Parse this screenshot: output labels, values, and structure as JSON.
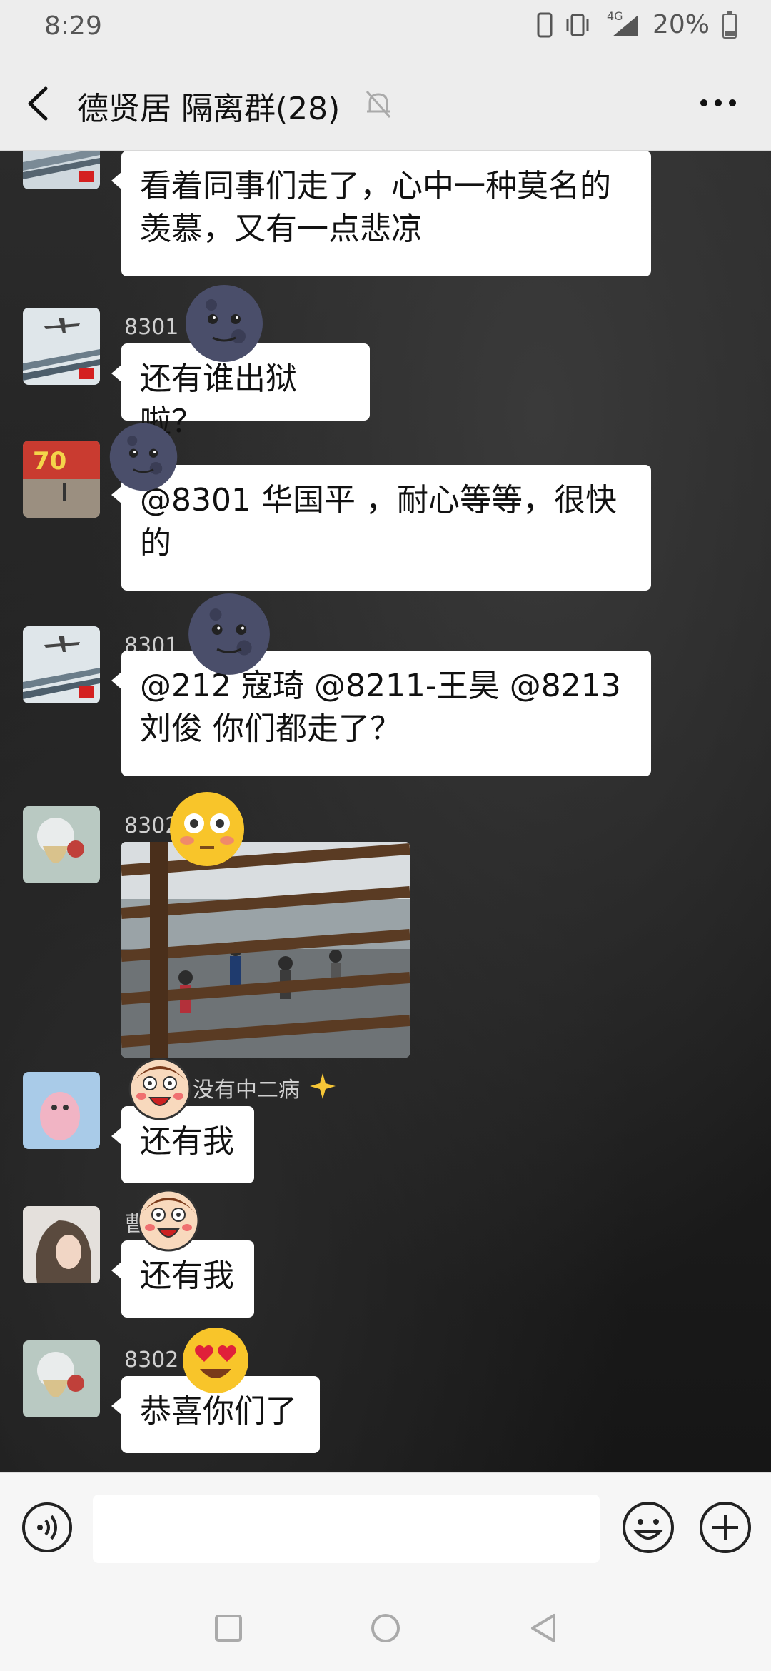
{
  "status_bar": {
    "time": "8:29",
    "network": "4G",
    "battery": "20%"
  },
  "header": {
    "title": "德贤居  隔离群(28)"
  },
  "messages": [
    {
      "sender": "",
      "text_lines": [
        "看着同事们走了，心中一种莫名的",
        "羡慕，又有一点悲凉"
      ]
    },
    {
      "sender": "8301",
      "text_lines": [
        "还有谁出狱啦？"
      ]
    },
    {
      "sender": "",
      "text_lines": [
        "@8301 华国平 ，耐心等等，很快",
        "的"
      ]
    },
    {
      "sender": "8301",
      "text_lines": [
        "@212 寇琦  @8211-王昊  @8213",
        "刘俊  你们都走了？"
      ]
    },
    {
      "sender": "8302",
      "image": "photo-railing"
    },
    {
      "sender": "没有中二病",
      "text_lines": [
        "还有我"
      ]
    },
    {
      "sender": "曹",
      "text_lines": [
        "还有我"
      ]
    },
    {
      "sender": "8302",
      "text_lines": [
        "恭喜你们了"
      ]
    }
  ],
  "input": {
    "placeholder": ""
  },
  "icons": {
    "back": "chevron-left-icon",
    "mute": "bell-off-icon",
    "more": "more-dots-icon",
    "voice": "voice-icon",
    "emoji": "emoji-icon",
    "plus": "plus-icon"
  },
  "colors": {
    "bar_background": "#ededed",
    "bubble": "#ffffff",
    "chat_background": "#1f1f1f"
  }
}
